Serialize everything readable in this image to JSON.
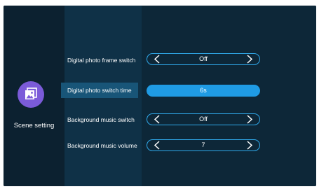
{
  "sidebar": {
    "label": "Scene setting",
    "icon": "image-gallery-icon",
    "icon_color": "#7b5bd9"
  },
  "settings": [
    {
      "label": "Digital photo frame switch",
      "value": "Off",
      "active": false
    },
    {
      "label": "Digital photo switch time",
      "value": "6s",
      "active": true
    },
    {
      "label": "Background music switch",
      "value": "Off",
      "active": false
    },
    {
      "label": "Background music volume",
      "value": "7",
      "active": false
    }
  ],
  "colors": {
    "accent": "#1f9be4",
    "background": "#0b2231",
    "active_row": "#185578"
  }
}
